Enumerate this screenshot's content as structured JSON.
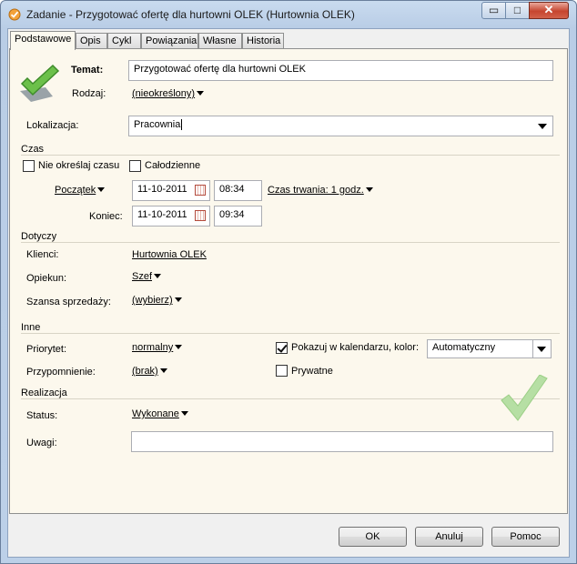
{
  "window": {
    "title": "Zadanie - Przygotować ofertę dla hurtowni OLEK (Hurtownia OLEK)",
    "minimize_glyph": "▭",
    "maximize_glyph": "□",
    "close_glyph": "✕"
  },
  "tabs": [
    {
      "label": "Podstawowe",
      "active": true
    },
    {
      "label": "Opis"
    },
    {
      "label": "Cykl"
    },
    {
      "label": "Powiązania"
    },
    {
      "label": "Własne"
    },
    {
      "label": "Historia"
    }
  ],
  "header": {
    "subject_label": "Temat:",
    "subject_value": "Przygotować ofertę dla hurtowni OLEK",
    "type_label": "Rodzaj:",
    "type_value": "(nieokreślony)"
  },
  "location": {
    "label": "Lokalizacja:",
    "value": "Pracownia"
  },
  "time": {
    "section": "Czas",
    "no_time_label": "Nie określaj czasu",
    "all_day_label": "Całodzienne",
    "start_link": "Początek",
    "start_date": "11-10-2011",
    "start_time": "08:34",
    "duration_link": "Czas trwania: 1 godz.",
    "end_label": "Koniec:",
    "end_date": "11-10-2011",
    "end_time": "09:34"
  },
  "concerns": {
    "section": "Dotyczy",
    "clients_label": "Klienci:",
    "clients_value": "Hurtownia OLEK",
    "guardian_label": "Opiekun:",
    "guardian_value": "Szef",
    "chance_label": "Szansa sprzedaży:",
    "chance_value": "(wybierz)"
  },
  "other": {
    "section": "Inne",
    "priority_label": "Priorytet:",
    "priority_value": "normalny",
    "show_calendar_label": "Pokazuj w kalendarzu, kolor:",
    "show_calendar_checked": true,
    "color_value": "Automatyczny",
    "reminder_label": "Przypomnienie:",
    "reminder_value": "(brak)",
    "private_label": "Prywatne",
    "private_checked": false
  },
  "realization": {
    "section": "Realizacja",
    "status_label": "Status:",
    "status_value": "Wykonane",
    "notes_label": "Uwagi:",
    "notes_value": ""
  },
  "buttons": {
    "ok": "OK",
    "cancel": "Anuluj",
    "help": "Pomoc"
  },
  "colors": {
    "panel_bg": "#fcf8ed",
    "check_green": "#6cc04a",
    "close_red": "#c6452f"
  },
  "icons": [
    "task-app-icon",
    "task-checkmark-icon",
    "done-checkmark-icon",
    "calendar-icon"
  ]
}
